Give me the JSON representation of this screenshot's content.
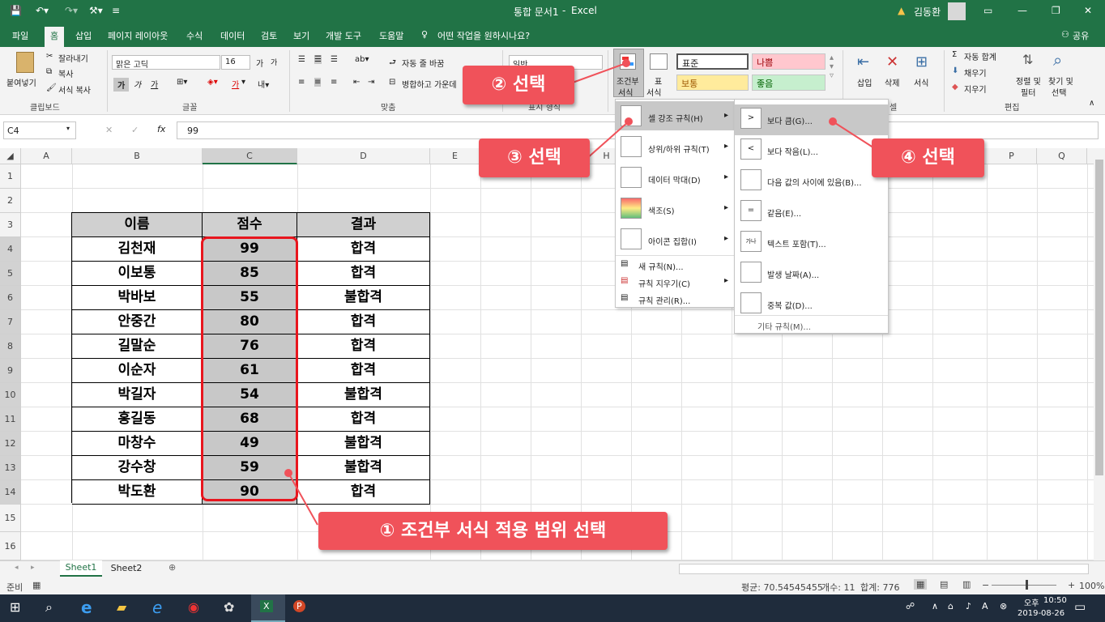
{
  "window": {
    "doc_title": "통합 문서1",
    "app_sep": "-",
    "app": "Excel",
    "user": "김동환",
    "warning_icon": "warning-icon"
  },
  "tabs": [
    "파일",
    "홈",
    "삽입",
    "페이지 레이아웃",
    "수식",
    "데이터",
    "검토",
    "보기",
    "개발 도구",
    "도움말"
  ],
  "tell_me": "어떤 작업을 원하시나요?",
  "share": "공유",
  "ribbon": {
    "clipboard": {
      "paste": "붙여넣기",
      "cut": "잘라내기",
      "copy": "복사",
      "format_painter": "서식 복사",
      "label": "클립보드"
    },
    "font": {
      "name": "맑은 고딕",
      "size": "16",
      "bold": "가",
      "italic": "가",
      "underline": "가",
      "font_color_glyph": "가",
      "grow": "가",
      "shrink": "가",
      "label": "글꼴"
    },
    "align": {
      "wrap": "자동 줄 바꿈",
      "merge": "병합하고 가운데",
      "label": "맞춤"
    },
    "number": {
      "format": "일반",
      "label": "표시 형식"
    },
    "styles": {
      "cond_format": "조건부",
      "cond_format2": "서식",
      "table": "표",
      "table2": "서식",
      "normal": "표준",
      "bad": "나쁨",
      "neutral": "보통",
      "good": "좋음"
    },
    "cells": {
      "insert": "삽입",
      "delete": "삭제",
      "format": "서식",
      "label": "셀"
    },
    "editing": {
      "autosum": "자동 합계",
      "fill": "채우기",
      "clear": "지우기",
      "sort": "정렬 및",
      "sort2": "필터",
      "find": "찾기 및",
      "find2": "선택",
      "label": "편집"
    }
  },
  "formula_bar": {
    "name_box": "C4",
    "fx": "fx",
    "value": "99"
  },
  "columns": [
    "A",
    "B",
    "C",
    "D",
    "E",
    "",
    "",
    "H",
    "",
    "",
    "",
    "",
    "",
    "",
    "",
    "P",
    "Q"
  ],
  "rows": [
    "1",
    "2",
    "3",
    "4",
    "5",
    "6",
    "7",
    "8",
    "9",
    "10",
    "11",
    "12",
    "13",
    "14",
    "15",
    "16"
  ],
  "table": {
    "headers": [
      "이름",
      "점수",
      "결과"
    ],
    "rows": [
      [
        "김천재",
        "99",
        "합격"
      ],
      [
        "이보통",
        "85",
        "합격"
      ],
      [
        "박바보",
        "55",
        "불합격"
      ],
      [
        "안중간",
        "80",
        "합격"
      ],
      [
        "길말순",
        "76",
        "합격"
      ],
      [
        "이순자",
        "61",
        "합격"
      ],
      [
        "박길자",
        "54",
        "불합격"
      ],
      [
        "홍길동",
        "68",
        "합격"
      ],
      [
        "마창수",
        "49",
        "불합격"
      ],
      [
        "강수창",
        "59",
        "불합격"
      ],
      [
        "박도환",
        "90",
        "합격"
      ]
    ]
  },
  "cf_menu": {
    "items": [
      "셀 강조 규칙(H)",
      "상위/하위 규칙(T)",
      "데이터 막대(D)",
      "색조(S)",
      "아이콘 집합(I)"
    ],
    "small": [
      "새 규칙(N)...",
      "규칙 지우기(C)",
      "규칙 관리(R)..."
    ]
  },
  "sub_menu": {
    "items": [
      "보다 큼(G)...",
      "보다 작음(L)...",
      "다음 값의 사이에 있음(B)...",
      "같음(E)...",
      "텍스트 포함(T)...",
      "발생 날짜(A)...",
      "중복 값(D)..."
    ],
    "more": "기타 규칙(M)...",
    "text_icon_label": "가나"
  },
  "callouts": {
    "c1": "① 조건부 서식 적용 범위 선택",
    "c2": "② 선택",
    "c3": "③ 선택",
    "c4": "④ 선택"
  },
  "sheets": [
    "Sheet1",
    "Sheet2"
  ],
  "status": {
    "ready": "준비",
    "average": "평균: 70.54545455",
    "count": "개수: 11",
    "sum": "합계: 776",
    "zoom": "100%"
  },
  "taskbar": {
    "ampm": "오후",
    "time": "10:50",
    "date": "2019-08-26"
  },
  "colors": {
    "excel_green": "#217346",
    "callout": "#f0525a",
    "bad_bg": "#ffc7ce",
    "neutral_bg": "#ffeb9c",
    "good_bg": "#c6efce"
  }
}
